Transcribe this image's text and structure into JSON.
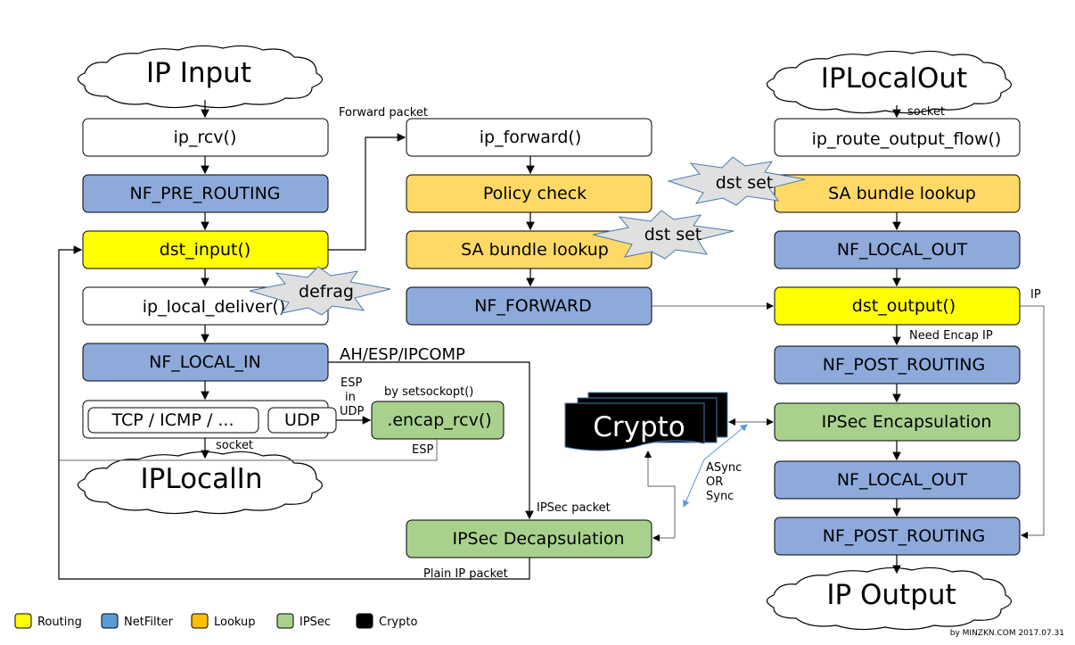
{
  "colors": {
    "routing": "#ffff00",
    "netfilter": "#8eaadb",
    "lookup": "#ffd966",
    "ipsec": "#a9d18e",
    "crypto": "#000000",
    "legend_netfilter": "#5b9bd5",
    "legend_lookup": "#ffc000"
  },
  "clouds": {
    "ip_input": "IP Input",
    "ip_local_in": "IPLocalIn",
    "ip_local_out": "IPLocalOut",
    "ip_output": "IP Output"
  },
  "left": [
    "ip_rcv()",
    "NF_PRE_ROUTING",
    "dst_input()",
    "ip_local_deliver()",
    "NF_LOCAL_IN"
  ],
  "tcp": "TCP / ICMP / ...",
  "udp": "UDP",
  "encap": ".encap_rcv()",
  "middle": [
    "ip_forward()",
    "Policy check",
    "SA bundle lookup",
    "NF_FORWARD"
  ],
  "decap": "IPSec Decapsulation",
  "right": [
    "ip_route_output_flow()",
    "SA bundle lookup",
    "NF_LOCAL_OUT",
    "dst_output()",
    "NF_POST_ROUTING",
    "IPSec Encapsulation",
    "NF_LOCAL_OUT",
    "NF_POST_ROUTING"
  ],
  "crypto": "Crypto",
  "bursts": {
    "dst_set_1": "dst set",
    "dst_set_2": "dst set",
    "defrag": "defrag"
  },
  "labels": {
    "forward_packet": "Forward packet",
    "ah_esp": "AH/ESP/IPCOMP",
    "esp_in": "ESP",
    "in": "in",
    "udp_l": "UDP",
    "setsockopt": "by setsockopt()",
    "socket_in": "socket",
    "esp": "ESP",
    "ipsec_packet": "IPSec packet",
    "plain_ip": "Plain IP packet",
    "socket_out": "socket",
    "ip": "IP",
    "need_encap": "Need Encap IP",
    "async": "ASync",
    "or": "OR",
    "sync": "Sync"
  },
  "legend": [
    "Routing",
    "NetFilter",
    "Lookup",
    "IPSec",
    "Crypto"
  ],
  "credit": "by MINZKN.COM 2017.07.31"
}
